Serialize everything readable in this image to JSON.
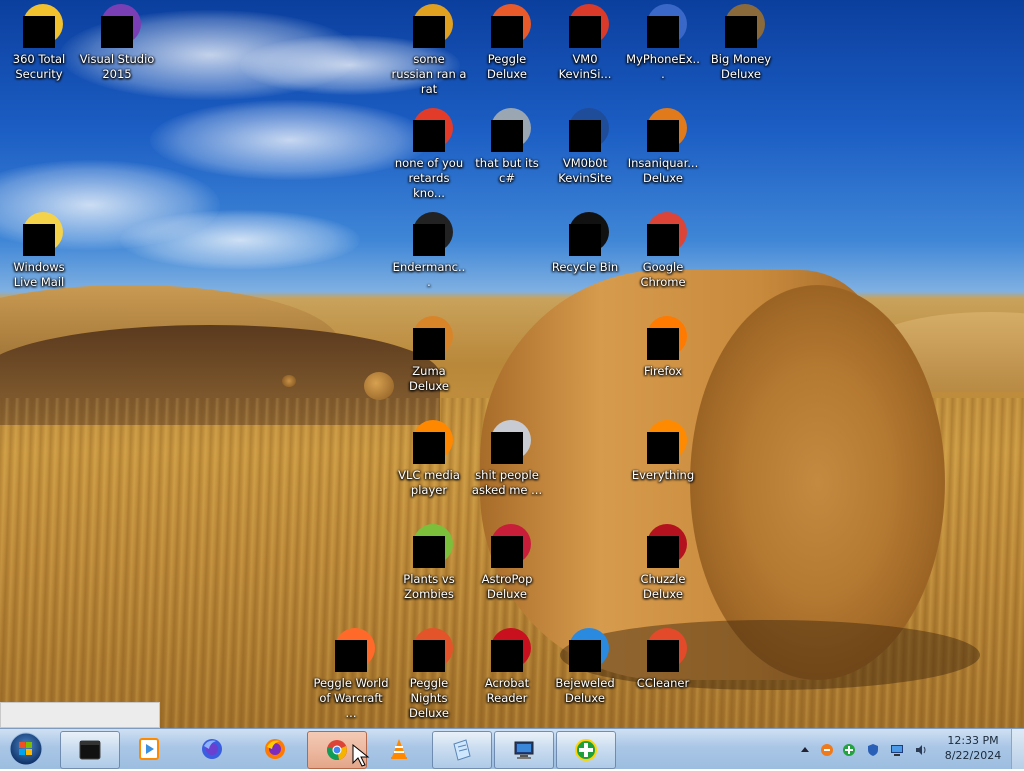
{
  "desktop": {
    "icons": [
      {
        "label": "360 Total Security"
      },
      {
        "label": "Visual Studio 2015"
      },
      {
        "label": "some russian ran a rat"
      },
      {
        "label": "Peggle Deluxe"
      },
      {
        "label": "VM0 KevinSi..."
      },
      {
        "label": "MyPhoneEx..."
      },
      {
        "label": "Big Money Deluxe"
      },
      {
        "label": "none of you retards kno..."
      },
      {
        "label": "that but its c#"
      },
      {
        "label": "VM0b0t KevinSite"
      },
      {
        "label": "Insaniquar... Deluxe"
      },
      {
        "label": "Windows Live Mail"
      },
      {
        "label": "Endermanc..."
      },
      {
        "label": "Recycle Bin"
      },
      {
        "label": "Google Chrome"
      },
      {
        "label": "Zuma Deluxe"
      },
      {
        "label": "Firefox"
      },
      {
        "label": "VLC media player"
      },
      {
        "label": "shit people asked me ..."
      },
      {
        "label": "Everything"
      },
      {
        "label": "Plants vs Zombies"
      },
      {
        "label": "AstroPop Deluxe"
      },
      {
        "label": "Chuzzle Deluxe"
      },
      {
        "label": "Peggle World of Warcraft ..."
      },
      {
        "label": "Peggle Nights Deluxe"
      },
      {
        "label": "Acrobat Reader"
      },
      {
        "label": "Bejeweled Deluxe"
      },
      {
        "label": "CCleaner"
      }
    ]
  },
  "taskbar": {
    "start_icon": "windows-orb-icon",
    "pinned": [
      {
        "name": "command-prompt",
        "icon": "terminal-icon"
      },
      {
        "name": "media-player",
        "icon": "media-player-icon"
      },
      {
        "name": "firefox-nightly",
        "icon": "firefox-blue-icon"
      },
      {
        "name": "firefox",
        "icon": "firefox-icon"
      },
      {
        "name": "google-chrome",
        "icon": "chrome-icon",
        "active": true
      },
      {
        "name": "vlc",
        "icon": "vlc-cone-icon"
      },
      {
        "name": "notepad",
        "icon": "notepad-icon"
      },
      {
        "name": "computer",
        "icon": "computer-icon"
      },
      {
        "name": "360-total-security",
        "icon": "360-security-icon"
      }
    ],
    "clock": {
      "time": "12:33 PM",
      "date": "8/22/2024"
    }
  },
  "colors": {
    "taskbar": "#a9c6e6",
    "active_button": "#e4a68a",
    "label_text": "#ffffff"
  }
}
